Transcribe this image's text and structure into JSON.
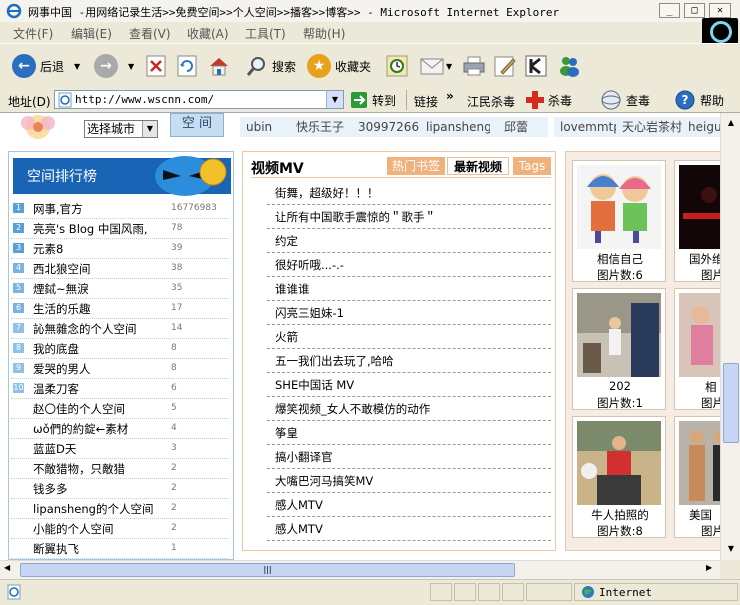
{
  "window": {
    "title": "网事中国 -用网络记录生活>>免费空间>>个人空间>>播客>>博客>> - Microsoft Internet Explorer"
  },
  "menu": [
    "文件(F)",
    "编辑(E)",
    "查看(V)",
    "收藏(A)",
    "工具(T)",
    "帮助(H)"
  ],
  "toolbar": {
    "back": "后退",
    "search": "搜索",
    "favorites": "收藏夹"
  },
  "addressbar": {
    "label": "地址(D)",
    "url": "http://www.wscnn.com/",
    "go": "转到",
    "links": "链接",
    "chevron": "»",
    "links_items": [
      "江民杀毒",
      "杀毒",
      "查毒",
      "帮助"
    ]
  },
  "page": {
    "city_select": "选择城市",
    "space_button": "空 间",
    "top_tags": [
      "ubin",
      "快乐王子",
      "309972669",
      "lipansheng",
      "邱蕾",
      "lovemmtp",
      "天心岩茶村",
      "heigu"
    ],
    "ranking": {
      "title": "空间排行榜",
      "rows": [
        {
          "rank": "1",
          "name": "网事,官方",
          "count": "16776983"
        },
        {
          "rank": "2",
          "name": "亮亮's Blog 中国风雨,",
          "count": "78"
        },
        {
          "rank": "3",
          "name": "元素8",
          "count": "39"
        },
        {
          "rank": "4",
          "name": "西北狼空间",
          "count": "38"
        },
        {
          "rank": "5",
          "name": "煙鋱~無淚",
          "count": "35"
        },
        {
          "rank": "6",
          "name": "生活的乐趣",
          "count": "17"
        },
        {
          "rank": "7",
          "name": "訫無雜念的个人空间",
          "count": "14"
        },
        {
          "rank": "8",
          "name": "我的底盘",
          "count": "8"
        },
        {
          "rank": "9",
          "name": "爱哭的男人",
          "count": "8"
        },
        {
          "rank": "10",
          "name": "温柔刀客",
          "count": "6"
        },
        {
          "rank": "",
          "name": "赵〇佳的个人空间",
          "count": "5"
        },
        {
          "rank": "",
          "name": "ωǒ們的約錠←素材",
          "count": "4"
        },
        {
          "rank": "",
          "name": "蓝蓝D天",
          "count": "3"
        },
        {
          "rank": "",
          "name": "不敵猎物，只敵猎",
          "count": "2"
        },
        {
          "rank": "",
          "name": "钱多多",
          "count": "2"
        },
        {
          "rank": "",
          "name": "lipansheng的个人空间",
          "count": "2"
        },
        {
          "rank": "",
          "name": "小能的个人空间",
          "count": "2"
        },
        {
          "rank": "",
          "name": "断翼执飞",
          "count": "1"
        }
      ]
    },
    "videos": {
      "title": "视频MV",
      "tabs": [
        "热门书签",
        "最新视频",
        "Tags"
      ],
      "items": [
        "街舞，超级好！！！",
        "让所有中国歌手震惊的＂歌手＂",
        "约定",
        "很好听哦...-.-",
        "谁谁谁",
        "闪亮三姐妹-1",
        "火箭",
        "五一我们出去玩了,哈哈",
        "SHE中国话 MV",
        "爆笑视频_女人不敢模仿的动作",
        "筝皇",
        "搞小翻译官",
        "大嘴巴河马搞笑MV",
        "感人MTV",
        "感人MTV"
      ]
    },
    "photos": [
      {
        "caption": "相信自己",
        "count": "图片数:6"
      },
      {
        "caption": "国外维",
        "count": "图片"
      },
      {
        "caption": "202",
        "count": "图片数:1"
      },
      {
        "caption": "相",
        "count": "图片"
      },
      {
        "caption": "牛人拍照的",
        "count": "图片数:8"
      },
      {
        "caption": "美国",
        "count": "图片"
      }
    ]
  },
  "status": {
    "zone": "Internet"
  }
}
